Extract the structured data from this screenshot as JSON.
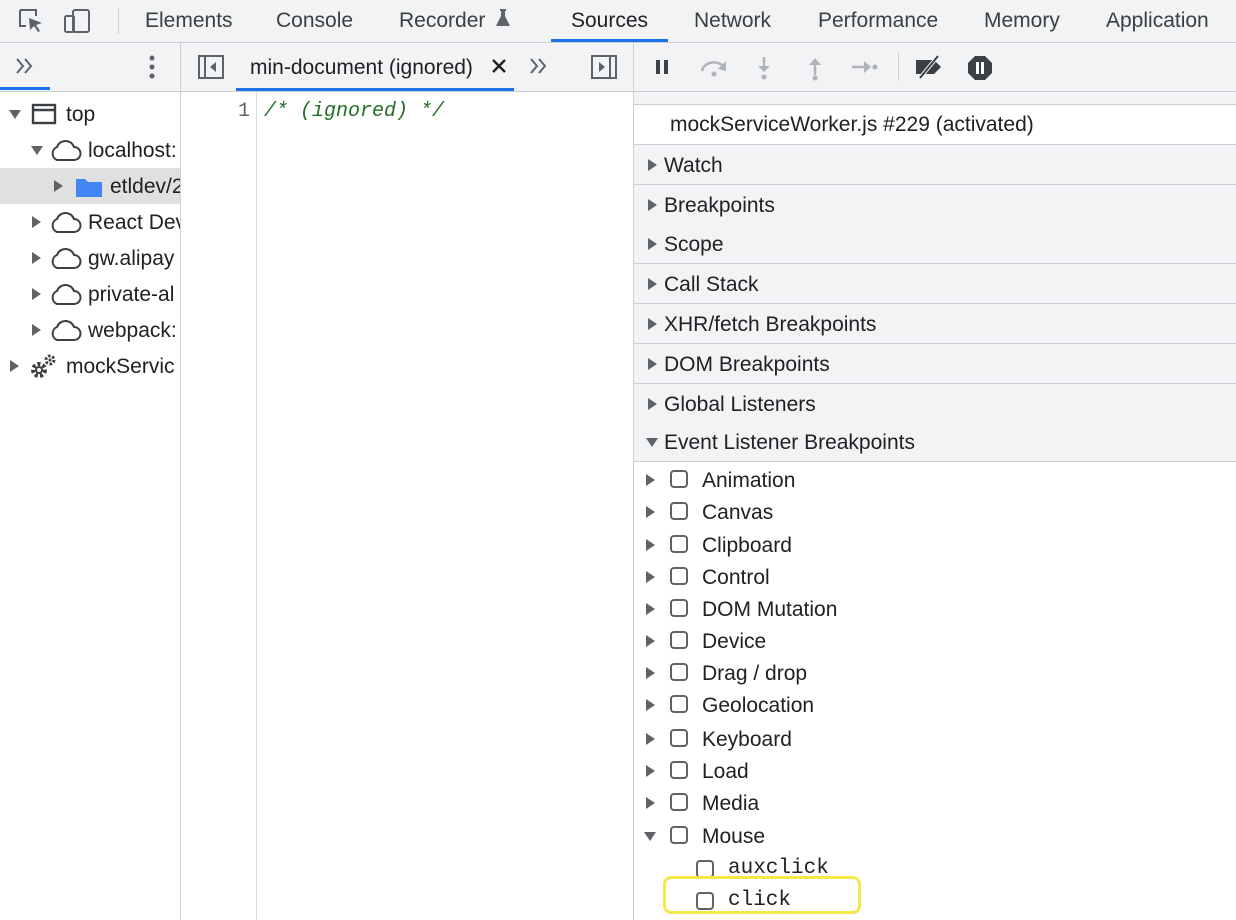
{
  "colors": {
    "accent": "#1a73e8",
    "folder": "#4285f4",
    "comment": "#236e25",
    "highlight": "#f5e84a"
  },
  "toolbar": {
    "tabs": [
      "Elements",
      "Console",
      "Recorder",
      "Sources",
      "Network",
      "Performance",
      "Memory",
      "Application"
    ],
    "active_tab": "Sources"
  },
  "navigator": {
    "items": [
      {
        "label": "top",
        "icon": "frame-icon"
      },
      {
        "label": "localhost:",
        "icon": "cloud-icon"
      },
      {
        "label": "etldev/2",
        "icon": "folder-icon",
        "selected": true
      },
      {
        "label": "React Dev",
        "icon": "cloud-icon"
      },
      {
        "label": "gw.alipay",
        "icon": "cloud-icon"
      },
      {
        "label": "private-al",
        "icon": "cloud-icon"
      },
      {
        "label": "webpack:",
        "icon": "cloud-icon"
      },
      {
        "label": "mockServic",
        "icon": "gear-icon"
      }
    ]
  },
  "editor": {
    "tab_label": "min-document (ignored)",
    "lines": [
      {
        "number": "1",
        "text": "/* (ignored) */"
      }
    ]
  },
  "debugger": {
    "thread_label": "mockServiceWorker.js #229 (activated)",
    "sections": [
      "Watch",
      "Breakpoints",
      "Scope",
      "Call Stack",
      "XHR/fetch Breakpoints",
      "DOM Breakpoints",
      "Global Listeners",
      "Event Listener Breakpoints"
    ],
    "event_categories": [
      "Animation",
      "Canvas",
      "Clipboard",
      "Control",
      "DOM Mutation",
      "Device",
      "Drag / drop",
      "Geolocation",
      "Keyboard",
      "Load",
      "Media",
      "Mouse"
    ],
    "mouse_events": [
      "auxclick",
      "click"
    ]
  }
}
